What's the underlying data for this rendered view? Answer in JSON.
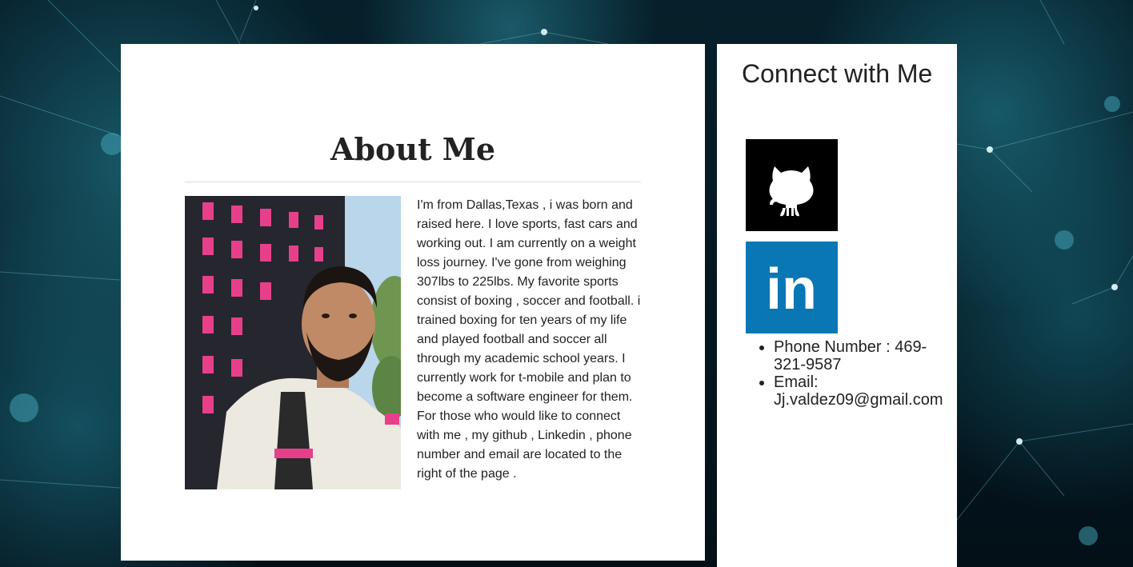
{
  "about": {
    "title": "About Me",
    "photo_alt": "profile-photo",
    "text": "I'm from Dallas,Texas , i was born and raised here. I love sports, fast cars and working out. I am currently on a weight loss journey. I've gone from weighing 307lbs to 225lbs. My favorite sports consist of boxing , soccer and football. i trained boxing for ten years of my life and played football and soccer all through my academic school years. I currently work for t-mobile and plan to become a software engineer for them. For those who would like to connect with me , my github , Linkedin , phone number and email are located to the right of the page ."
  },
  "connect": {
    "title": "Connect with Me",
    "github_icon": "github-icon",
    "linkedin_icon": "linkedin-icon",
    "linkedin_label": "in",
    "phone": "Phone Number : 469-321-9587",
    "email": "Email: Jj.valdez09@gmail.com"
  },
  "colors": {
    "card_bg": "#ffffff",
    "text": "#222222",
    "github_bg": "#000000",
    "linkedin_bg": "#0a77b5",
    "page_bg": "#04141c"
  }
}
